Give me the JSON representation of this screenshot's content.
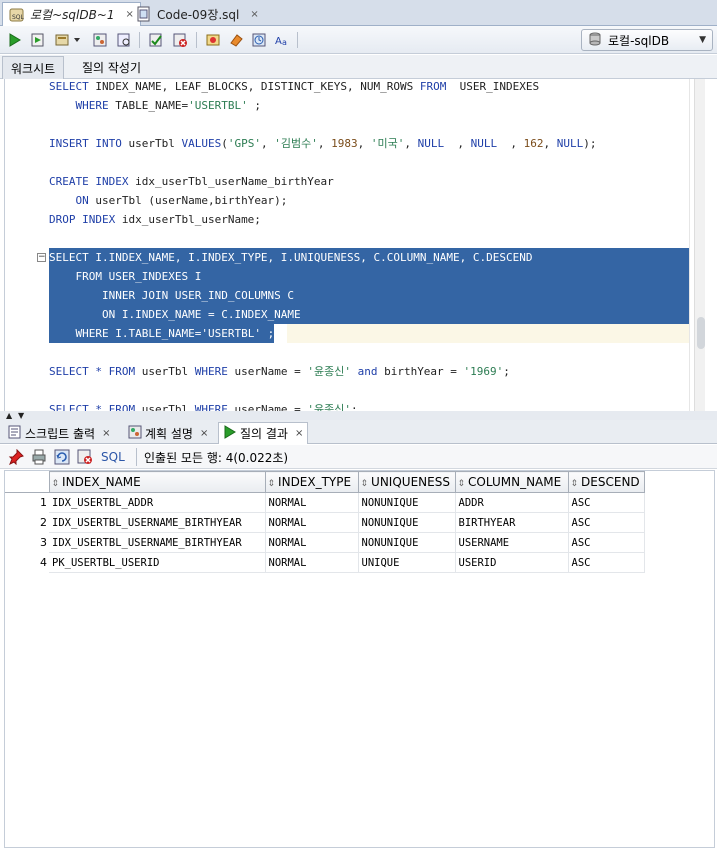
{
  "doc_tabs": [
    {
      "label": "로컬~sqlDB~1",
      "close": "×",
      "active": true
    },
    {
      "label": "Code-09장.sql",
      "close": "×",
      "active": false
    }
  ],
  "toolbar": {
    "connection": "로컬-sqlDB",
    "buttons": [
      "run-statement-icon",
      "run-script-icon",
      "commit-icon",
      "rollback-icon",
      "explain-plan-icon",
      "autotrace-icon",
      "sql-tuning-icon",
      "eraser-icon",
      "history-icon",
      "format-icon"
    ]
  },
  "sub_tabs": [
    "워크시트",
    "질의 작성기"
  ],
  "editor": {
    "lines": [
      {
        "kind": "normal",
        "html_parts": [
          [
            "kw",
            "SELECT"
          ],
          [
            "t",
            " INDEX_NAME, LEAF_BLOCKS, DISTINCT_KEYS, NUM_ROWS "
          ],
          [
            "kw",
            "FROM"
          ],
          [
            "t",
            "  USER_INDEXES"
          ]
        ]
      },
      {
        "kind": "normal",
        "html_parts": [
          [
            "t",
            "    "
          ],
          [
            "kw",
            "WHERE"
          ],
          [
            "t",
            " TABLE_NAME="
          ],
          [
            "str",
            "'USERTBL'"
          ],
          [
            "t",
            " ;"
          ]
        ]
      },
      {
        "kind": "blank",
        "html_parts": []
      },
      {
        "kind": "normal",
        "html_parts": [
          [
            "kw",
            "INSERT INTO"
          ],
          [
            "t",
            " userTbl "
          ],
          [
            "kw",
            "VALUES"
          ],
          [
            "t",
            "("
          ],
          [
            "str",
            "'GPS'"
          ],
          [
            "t",
            ", "
          ],
          [
            "str",
            "'김범수'"
          ],
          [
            "t",
            ", "
          ],
          [
            "num",
            "1983"
          ],
          [
            "t",
            ", "
          ],
          [
            "str",
            "'미국'"
          ],
          [
            "t",
            ", "
          ],
          [
            "kw",
            "NULL"
          ],
          [
            "t",
            "  , "
          ],
          [
            "kw",
            "NULL"
          ],
          [
            "t",
            "  , "
          ],
          [
            "num",
            "162"
          ],
          [
            "t",
            ", "
          ],
          [
            "kw",
            "NULL"
          ],
          [
            "t",
            ");"
          ]
        ]
      },
      {
        "kind": "blank",
        "html_parts": []
      },
      {
        "kind": "normal",
        "html_parts": [
          [
            "kw",
            "CREATE INDEX"
          ],
          [
            "t",
            " idx_userTbl_userName_birthYear"
          ]
        ]
      },
      {
        "kind": "normal",
        "html_parts": [
          [
            "t",
            "    "
          ],
          [
            "kw",
            "ON"
          ],
          [
            "t",
            " userTbl (userName,birthYear);"
          ]
        ]
      },
      {
        "kind": "normal",
        "html_parts": [
          [
            "kw",
            "DROP INDEX"
          ],
          [
            "t",
            " idx_userTbl_userName;"
          ]
        ]
      },
      {
        "kind": "blank",
        "html_parts": []
      },
      {
        "kind": "sel",
        "html_parts": [
          [
            "kw",
            "SELECT"
          ],
          [
            "t",
            " I.INDEX_NAME, I.INDEX_TYPE, I.UNIQUENESS, C.COLUMN_NAME, C.DESCEND"
          ]
        ]
      },
      {
        "kind": "sel",
        "html_parts": [
          [
            "t",
            "    "
          ],
          [
            "kw",
            "FROM"
          ],
          [
            "t",
            " USER_INDEXES I"
          ]
        ]
      },
      {
        "kind": "sel",
        "html_parts": [
          [
            "t",
            "        "
          ],
          [
            "kw",
            "INNER JOIN"
          ],
          [
            "t",
            " USER_IND_COLUMNS C"
          ]
        ]
      },
      {
        "kind": "sel",
        "html_parts": [
          [
            "t",
            "        "
          ],
          [
            "kw",
            "ON"
          ],
          [
            "t",
            " I.INDEX_NAME = C.INDEX_NAME"
          ]
        ]
      },
      {
        "kind": "sel-last",
        "html_parts": [
          [
            "t",
            "    "
          ],
          [
            "kw",
            "WHERE"
          ],
          [
            "t",
            " I.TABLE_NAME="
          ],
          [
            "str",
            "'USERTBL'"
          ],
          [
            "t",
            " ;"
          ]
        ]
      },
      {
        "kind": "blank",
        "html_parts": []
      },
      {
        "kind": "normal",
        "html_parts": [
          [
            "kw",
            "SELECT"
          ],
          [
            "t",
            " "
          ],
          [
            "kw",
            "*"
          ],
          [
            "t",
            " "
          ],
          [
            "kw",
            "FROM"
          ],
          [
            "t",
            " userTbl "
          ],
          [
            "kw",
            "WHERE"
          ],
          [
            "t",
            " userName = "
          ],
          [
            "str",
            "'윤종신'"
          ],
          [
            "t",
            " "
          ],
          [
            "kw",
            "and"
          ],
          [
            "t",
            " birthYear = "
          ],
          [
            "str",
            "'1969'"
          ],
          [
            "t",
            ";"
          ]
        ]
      },
      {
        "kind": "blank",
        "html_parts": []
      },
      {
        "kind": "normal",
        "html_parts": [
          [
            "kw",
            "SELECT"
          ],
          [
            "t",
            " "
          ],
          [
            "kw",
            "*"
          ],
          [
            "t",
            " "
          ],
          [
            "kw",
            "FROM"
          ],
          [
            "t",
            " userTbl "
          ],
          [
            "kw",
            "WHERE"
          ],
          [
            "t",
            " userName = "
          ],
          [
            "str",
            "'윤종신'"
          ],
          [
            "t",
            ";"
          ]
        ]
      }
    ]
  },
  "result_tabs": [
    {
      "label": "스크립트 출력",
      "close": "×",
      "icon": "script-output-icon"
    },
    {
      "label": "계획 설명",
      "close": "×",
      "icon": "explain-plan-icon"
    },
    {
      "label": "질의 결과",
      "close": "×",
      "icon": "query-result-icon"
    }
  ],
  "result_toolbar": {
    "sql_label": "SQL",
    "status": "인출된 모든 행: 4(0.022초)"
  },
  "grid": {
    "columns": [
      "INDEX_NAME",
      "INDEX_TYPE",
      "UNIQUENESS",
      "COLUMN_NAME",
      "DESCEND"
    ],
    "rows": [
      {
        "num": "1",
        "cells": [
          "IDX_USERTBL_ADDR",
          "NORMAL",
          "NONUNIQUE",
          "ADDR",
          "ASC"
        ]
      },
      {
        "num": "2",
        "cells": [
          "IDX_USERTBL_USERNAME_BIRTHYEAR",
          "NORMAL",
          "NONUNIQUE",
          "BIRTHYEAR",
          "ASC"
        ]
      },
      {
        "num": "3",
        "cells": [
          "IDX_USERTBL_USERNAME_BIRTHYEAR",
          "NORMAL",
          "NONUNIQUE",
          "USERNAME",
          "ASC"
        ]
      },
      {
        "num": "4",
        "cells": [
          "PK_USERTBL_USERID",
          "NORMAL",
          "UNIQUE",
          "USERID",
          "ASC"
        ]
      }
    ]
  }
}
